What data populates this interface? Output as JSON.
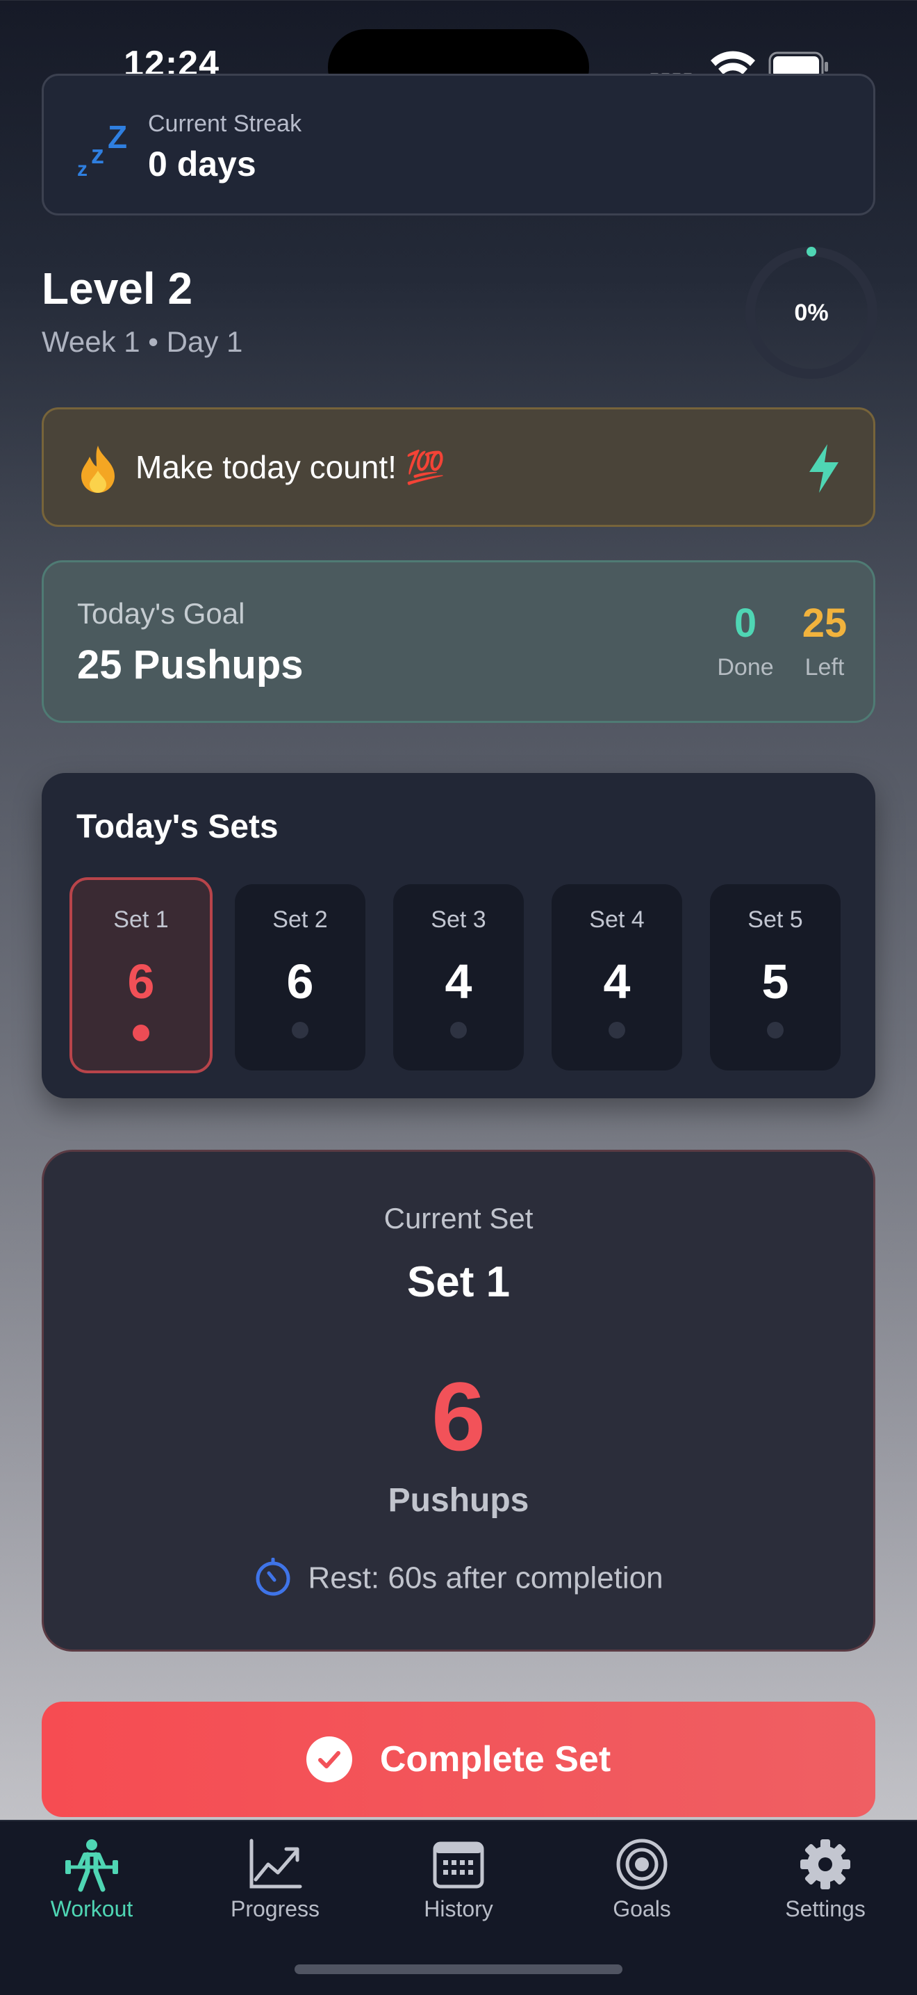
{
  "status_bar": {
    "time": "12:24"
  },
  "streak": {
    "label": "Current Streak",
    "value": "0 days",
    "icon": "sleeping-zzz-icon"
  },
  "level": {
    "title": "Level 2",
    "subtitle": "Week 1 • Day 1",
    "progress_text": "0%",
    "progress": 0
  },
  "motivation": {
    "text": "Make today count! 💯",
    "icon_left": "fire-icon",
    "icon_right": "lightning-icon"
  },
  "goal": {
    "label": "Today's Goal",
    "value": "25 Pushups",
    "done": {
      "value": "0",
      "label": "Done"
    },
    "left": {
      "value": "25",
      "label": "Left"
    }
  },
  "sets": {
    "title": "Today's Sets",
    "items": [
      {
        "name": "Set 1",
        "reps": "6"
      },
      {
        "name": "Set 2",
        "reps": "6"
      },
      {
        "name": "Set 3",
        "reps": "4"
      },
      {
        "name": "Set 4",
        "reps": "4"
      },
      {
        "name": "Set 5",
        "reps": "5"
      }
    ]
  },
  "current_set": {
    "label": "Current Set",
    "name": "Set 1",
    "reps": "6",
    "unit": "Pushups",
    "rest": "Rest: 60s after completion"
  },
  "complete_button": {
    "label": "Complete Set"
  },
  "tabs": [
    {
      "label": "Workout",
      "icon": "weightlifter-icon"
    },
    {
      "label": "Progress",
      "icon": "chart-icon"
    },
    {
      "label": "History",
      "icon": "calendar-icon"
    },
    {
      "label": "Goals",
      "icon": "target-icon"
    },
    {
      "label": "Settings",
      "icon": "gear-icon"
    }
  ],
  "colors": {
    "accent_red": "#f25259",
    "accent_teal": "#4fd6b4",
    "accent_orange": "#f2b33d",
    "background": "#161a27"
  }
}
